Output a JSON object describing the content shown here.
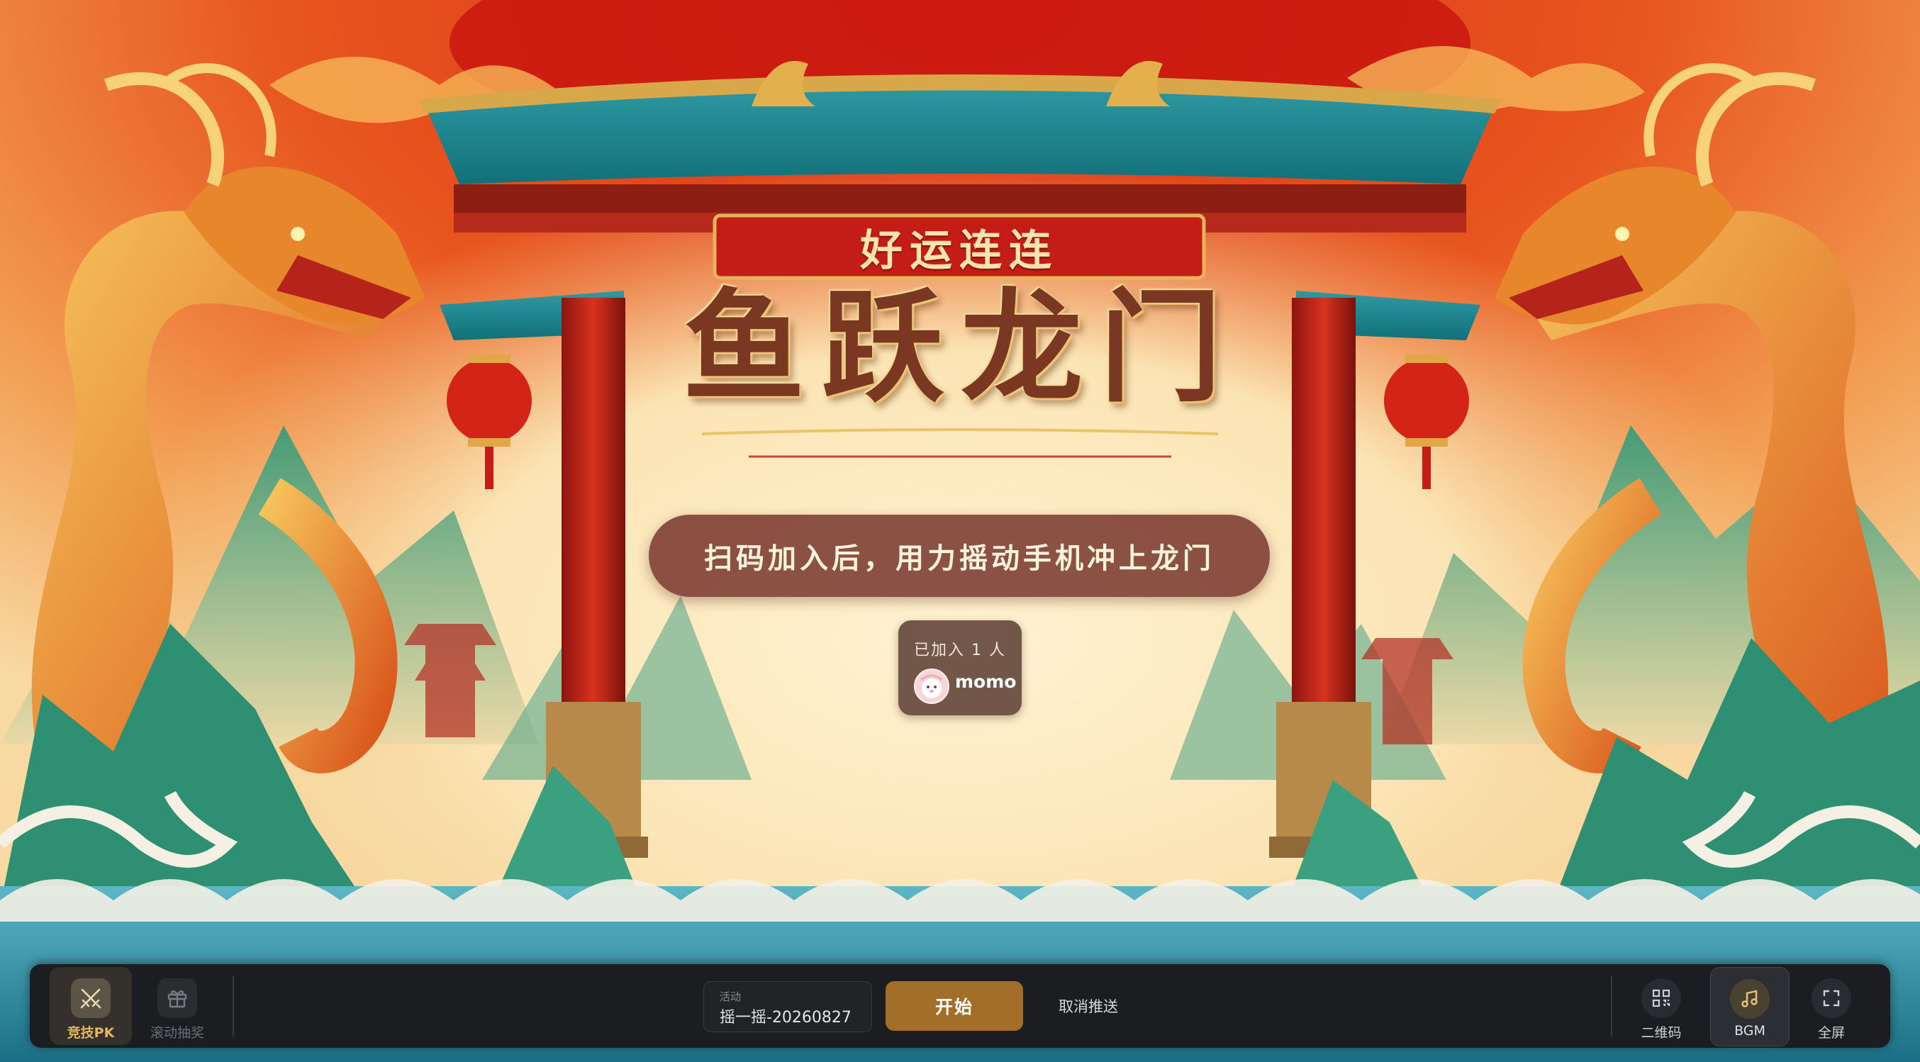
{
  "banner": {
    "subtitle": "好运连连",
    "title": "鱼跃龙门"
  },
  "instruction": "扫码加入后，用力摇动手机冲上龙门",
  "players": {
    "joined_label": "已加入 1 人",
    "list": [
      {
        "name": "momo"
      }
    ]
  },
  "toolbar": {
    "modes": [
      {
        "label": "竞技PK",
        "icon": "crossed-swords-icon",
        "active": true
      },
      {
        "label": "滚动抽奖",
        "icon": "gift-icon",
        "active": false
      }
    ],
    "activity": {
      "label": "活动",
      "value": "摇一摇-20260827"
    },
    "start_label": "开始",
    "cancel_push_label": "取消推送",
    "right_tools": [
      {
        "label": "二维码",
        "icon": "qr-code-icon"
      },
      {
        "label": "BGM",
        "icon": "music-note-icon",
        "active": true
      },
      {
        "label": "全屏",
        "icon": "fullscreen-icon"
      }
    ]
  },
  "colors": {
    "accent_gold": "#a36f28",
    "banner_red": "#c41d15",
    "toolbar_bg": "#1c1d21"
  }
}
